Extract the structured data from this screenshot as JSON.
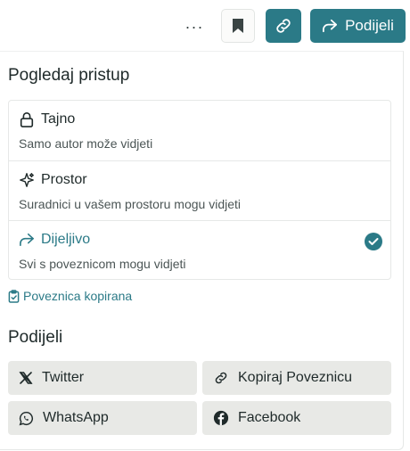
{
  "toolbar": {
    "more_label": "···",
    "share_label": "Podijeli",
    "accent_color": "#2b7a87"
  },
  "access": {
    "title": "Pogledaj pristup",
    "options": [
      {
        "label": "Tajno",
        "description": "Samo autor može vidjeti",
        "icon": "lock-icon",
        "selected": false
      },
      {
        "label": "Prostor",
        "description": "Suradnici u vašem prostoru mogu vidjeti",
        "icon": "sparkle-icon",
        "selected": false
      },
      {
        "label": "Dijeljivo",
        "description": "Svi s poveznicom mogu vidjeti",
        "icon": "share-arrow-icon",
        "selected": true
      }
    ]
  },
  "status": {
    "copied_label": "Poveznica kopirana"
  },
  "share": {
    "title": "Podijeli",
    "buttons": [
      {
        "label": "Twitter",
        "icon": "x-logo-icon"
      },
      {
        "label": "Kopiraj Poveznicu",
        "icon": "link-icon"
      },
      {
        "label": "WhatsApp",
        "icon": "whatsapp-icon"
      },
      {
        "label": "Facebook",
        "icon": "facebook-icon"
      }
    ]
  }
}
